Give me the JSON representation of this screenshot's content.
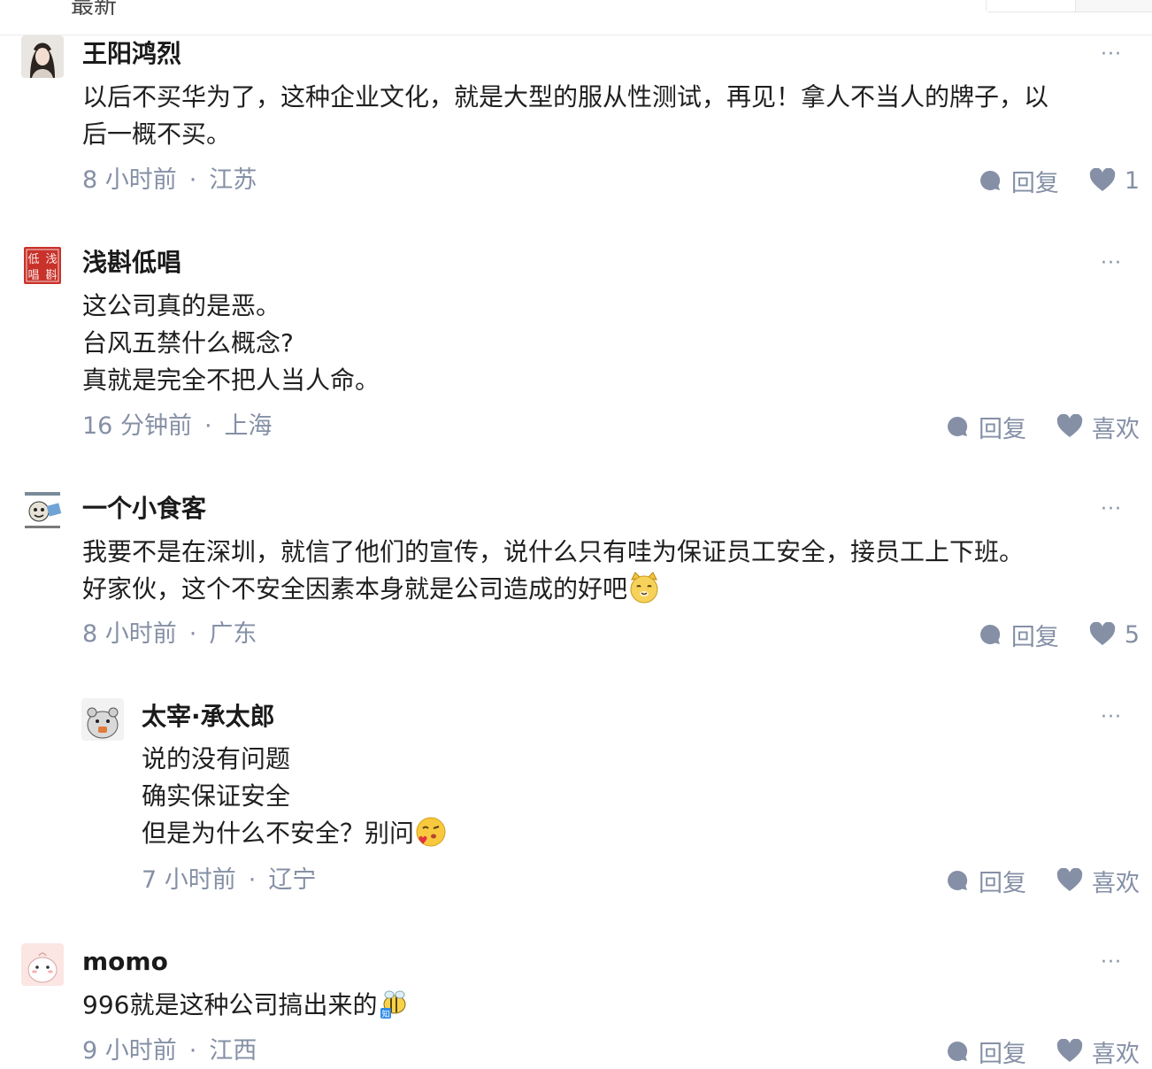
{
  "top": {
    "fragment": "最新"
  },
  "comments": [
    {
      "name": "王阳鸿烈",
      "lines": [
        "以后不买华为了，这种企业文化，就是大型的服从性测试，再见！拿人不当人的牌子，以",
        "后一概不买。"
      ],
      "time": "8 小时前",
      "location": "江苏",
      "reply": "回复",
      "like": "1",
      "more": "···"
    },
    {
      "name": "浅斟低唱",
      "lines": [
        "这公司真的是恶。",
        "台风五禁什么概念?",
        "真就是完全不把人当人命。"
      ],
      "time": "16 分钟前",
      "location": "上海",
      "reply": "回复",
      "like": "喜欢",
      "more": "···",
      "avatar_text": [
        "低浅",
        "唱斟"
      ]
    },
    {
      "name": "一个小食客",
      "lines": [
        "我要不是在深圳，就信了他们的宣传，说什么只有哇为保证员工安全，接员工上下班。",
        "好家伙，这个不安全因素本身就是公司造成的好吧"
      ],
      "time": "8 小时前",
      "location": "广东",
      "reply": "回复",
      "like": "5",
      "more": "···"
    },
    {
      "name": "太宰·承太郎",
      "lines": [
        "说的没有问题",
        "确实保证安全",
        "但是为什么不安全？别问"
      ],
      "time": "7 小时前",
      "location": "辽宁",
      "reply": "回复",
      "like": "喜欢",
      "more": "···"
    },
    {
      "name": "momo",
      "lines": [
        "996就是这种公司搞出来的"
      ],
      "time": "9 小时前",
      "location": "江西",
      "reply": "回复",
      "like": "喜欢",
      "more": "···"
    }
  ],
  "colors": {
    "meta": "#8590a6",
    "text": "#1f1f1f",
    "stamp": "#c8322b"
  },
  "icons": {
    "reply": "speech-bubble-icon",
    "like": "heart-icon"
  }
}
